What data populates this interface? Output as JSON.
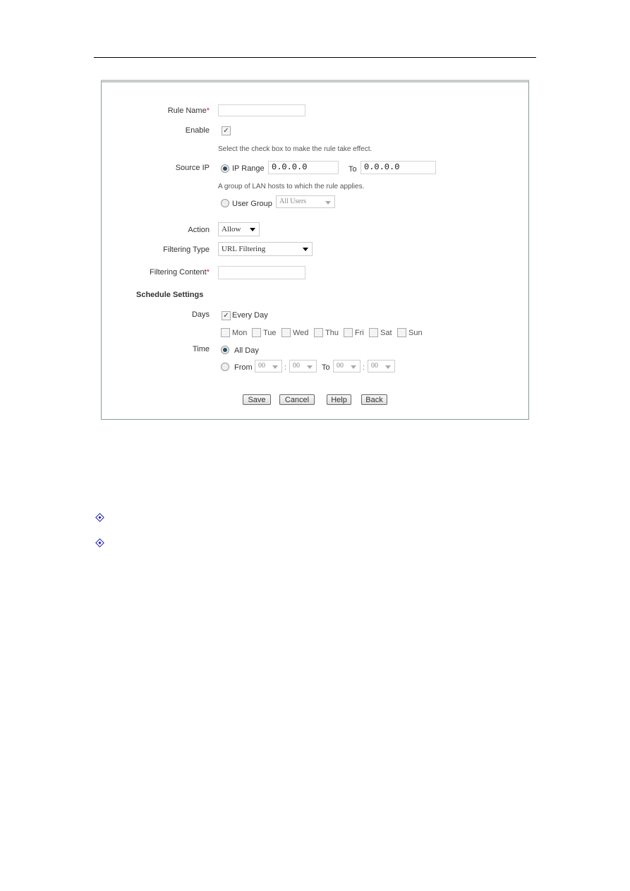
{
  "form": {
    "rule_name": {
      "label": "Rule Name",
      "required": "*",
      "value": ""
    },
    "enable": {
      "label": "Enable",
      "checked": true,
      "hint": "Select the check box to make the rule take effect."
    },
    "source_ip": {
      "label": "Source IP",
      "ip_range_label": "IP Range",
      "ip_from": "0.0.0.0",
      "to_label": "To",
      "ip_to": "0.0.0.0",
      "hint": "A group of LAN hosts to which the rule applies.",
      "user_group_label": "User Group",
      "user_group_value": "All Users",
      "selected": "IP Range"
    },
    "action": {
      "label": "Action",
      "value": "Allow"
    },
    "filtering_type": {
      "label": "Filtering Type",
      "value": "URL Filtering"
    },
    "filtering_content": {
      "label": "Filtering Content",
      "required": "*",
      "value": ""
    },
    "schedule": {
      "title": "Schedule Settings",
      "days_label": "Days",
      "every_day": "Every Day",
      "every_day_checked": true,
      "weekdays": [
        "Mon",
        "Tue",
        "Wed",
        "Thu",
        "Fri",
        "Sat",
        "Sun"
      ],
      "time_label": "Time",
      "all_day": "All Day",
      "from_label": "From",
      "to_label": "To",
      "colon": ":",
      "from_h": "00",
      "from_m": "00",
      "to_h": "00",
      "to_m": "00",
      "selected": "All Day"
    },
    "buttons": {
      "save": "Save",
      "cancel": "Cancel",
      "help": "Help",
      "back": "Back"
    }
  },
  "colors": {
    "required": "#c0303a",
    "bullet": "#2020a0",
    "panel_border": "#8a9a98"
  },
  "bullet_icon": "diamond-bullet-icon"
}
